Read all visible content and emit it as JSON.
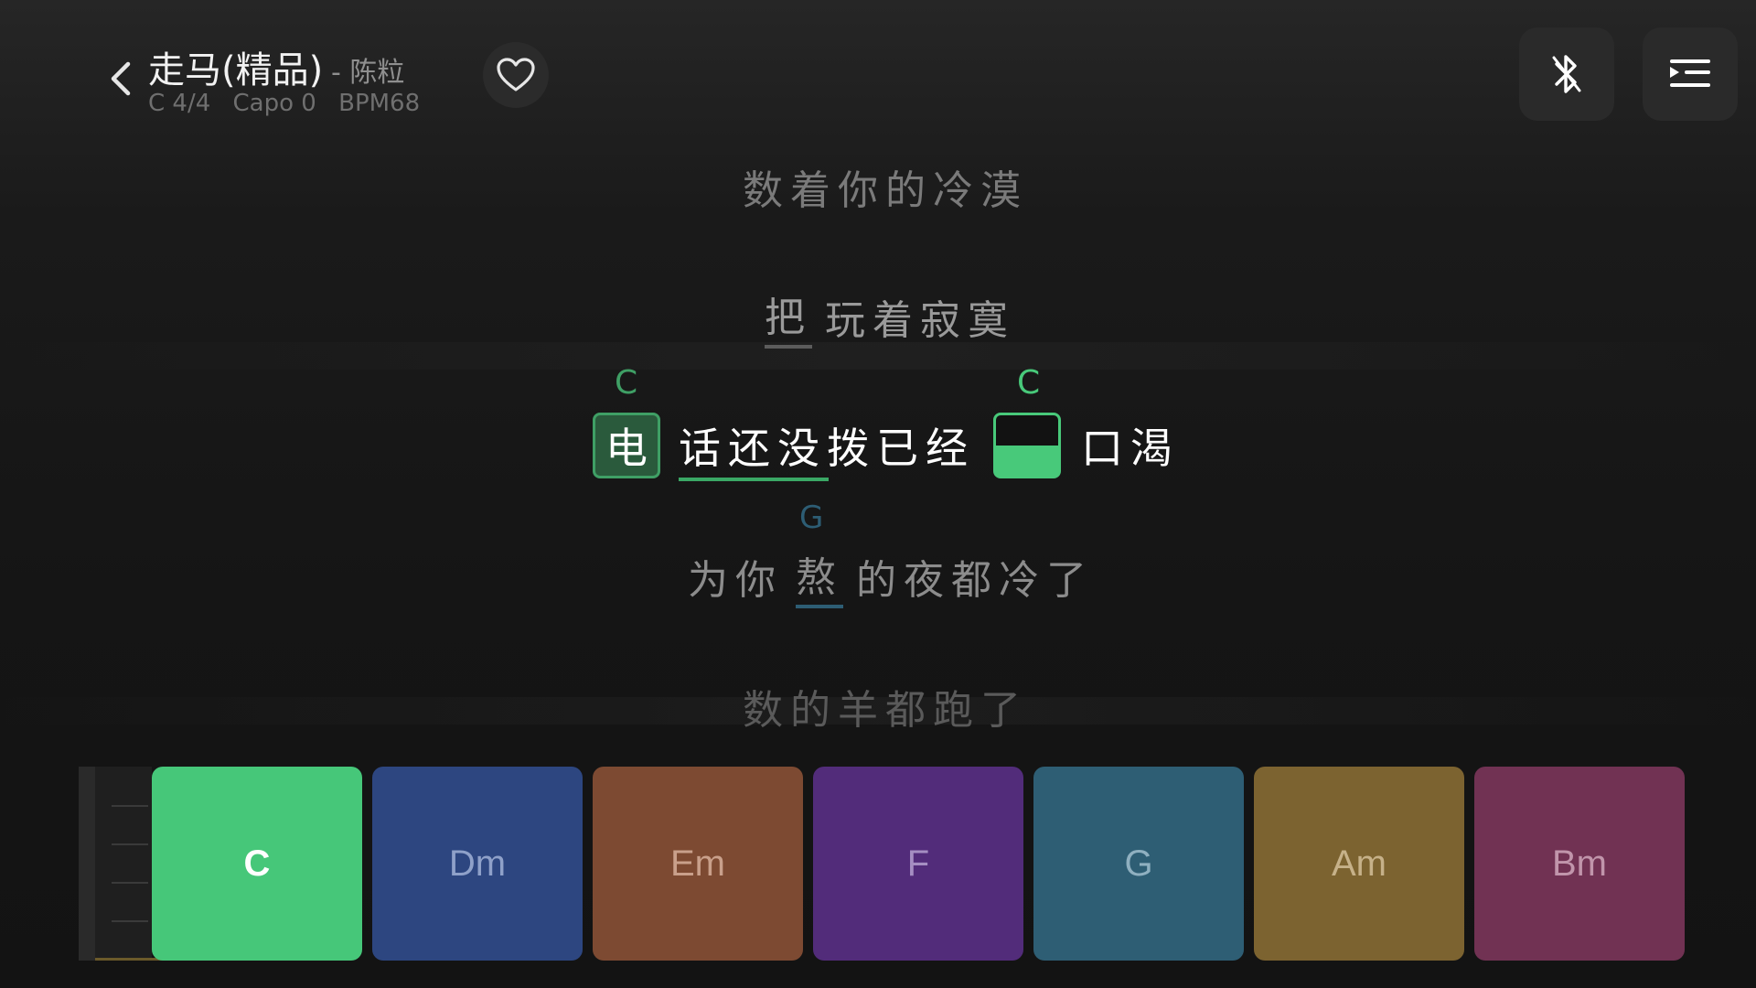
{
  "header": {
    "title": "走马(精品)",
    "artist": "- 陈粒",
    "meta": [
      "C 4/4",
      "Capo 0",
      "BPM68"
    ]
  },
  "lyrics": {
    "line0": "数着你的冷漠",
    "line1_marked": "把",
    "line1_rest": "玩着寂寞",
    "current": {
      "chord1": "C",
      "chord2": "C",
      "seg1": "电",
      "seg2": "话还没拨已经",
      "seg3": "",
      "seg4": "口渴"
    },
    "line3": {
      "chord": "G",
      "pre": "为你",
      "marked": "熬",
      "post": "的夜都冷了"
    },
    "line4": "数的羊都跑了"
  },
  "pads": [
    {
      "label": "C",
      "color": "#46c779",
      "text_color": "#ffffff"
    },
    {
      "label": "Dm",
      "color": "#2d4680",
      "text_color": "#8fa1c9"
    },
    {
      "label": "Em",
      "color": "#7d4a32",
      "text_color": "#c9a08b"
    },
    {
      "label": "F",
      "color": "#522c7a",
      "text_color": "#a58ec2"
    },
    {
      "label": "G",
      "color": "#2e5e74",
      "text_color": "#8fb0c0"
    },
    {
      "label": "Am",
      "color": "#7c6330",
      "text_color": "#c6b189"
    },
    {
      "label": "Bm",
      "color": "#713253",
      "text_color": "#c195ab"
    }
  ],
  "colors": {
    "accent_green": "#48c97a",
    "played_green": "#3f9f65",
    "upcoming_blue": "#2d5d74"
  },
  "icons": {
    "back": "chevron-left-icon",
    "favorite": "heart-icon",
    "bluetooth": "bluetooth-icon",
    "playlist": "playlist-icon"
  }
}
